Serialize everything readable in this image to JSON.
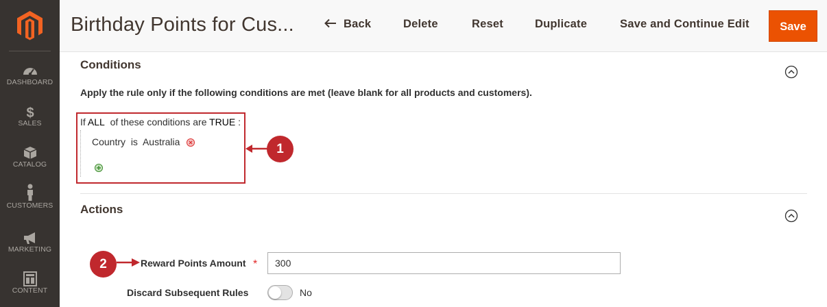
{
  "sidebar": {
    "items": [
      {
        "label": "DASHBOARD",
        "icon": "dashboard-icon"
      },
      {
        "label": "SALES",
        "icon": "dollar-icon"
      },
      {
        "label": "CATALOG",
        "icon": "box-icon"
      },
      {
        "label": "CUSTOMERS",
        "icon": "person-icon"
      },
      {
        "label": "MARKETING",
        "icon": "megaphone-icon"
      },
      {
        "label": "CONTENT",
        "icon": "layout-icon"
      }
    ]
  },
  "header": {
    "title": "Birthday Points for Cus...",
    "back_label": "Back",
    "delete_label": "Delete",
    "reset_label": "Reset",
    "duplicate_label": "Duplicate",
    "save_continue_label": "Save and Continue Edit",
    "save_label": "Save"
  },
  "conditions": {
    "title": "Conditions",
    "description": "Apply the rule only if the following conditions are met (leave blank for all products and customers).",
    "head_if": "If",
    "head_aggregator": "ALL",
    "head_mid": "of these conditions are",
    "head_value": "TRUE",
    "head_colon": ":",
    "rule": {
      "attribute": "Country",
      "operator": "is",
      "value": "Australia"
    },
    "callout": "1"
  },
  "actions": {
    "title": "Actions",
    "reward_label": "Reward Points Amount",
    "required_mark": "*",
    "reward_value": "300",
    "discard_label": "Discard Subsequent Rules",
    "discard_state": "No",
    "callout": "2"
  },
  "colors": {
    "accent": "#eb5202",
    "sidebar": "#373330",
    "callout": "#c0282d"
  }
}
